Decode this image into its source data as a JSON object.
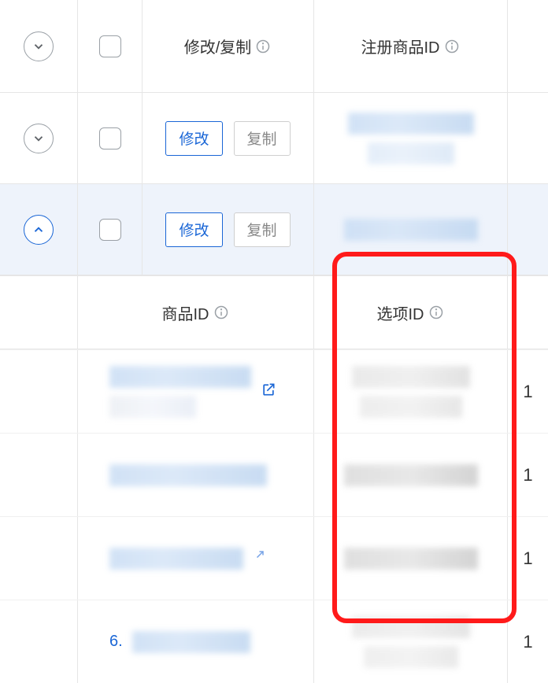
{
  "header": {
    "actions_title": "修改/复制",
    "regid_title": "注册商品ID"
  },
  "buttons": {
    "edit": "修改",
    "copy": "复制"
  },
  "sub_header": {
    "prodid_title": "商品ID",
    "optid_title": "选项ID"
  },
  "sub_rows": {
    "r4_prefix": "6."
  },
  "tail": {
    "r1": "1",
    "r2": "1",
    "r3": "1",
    "r4": "1"
  }
}
